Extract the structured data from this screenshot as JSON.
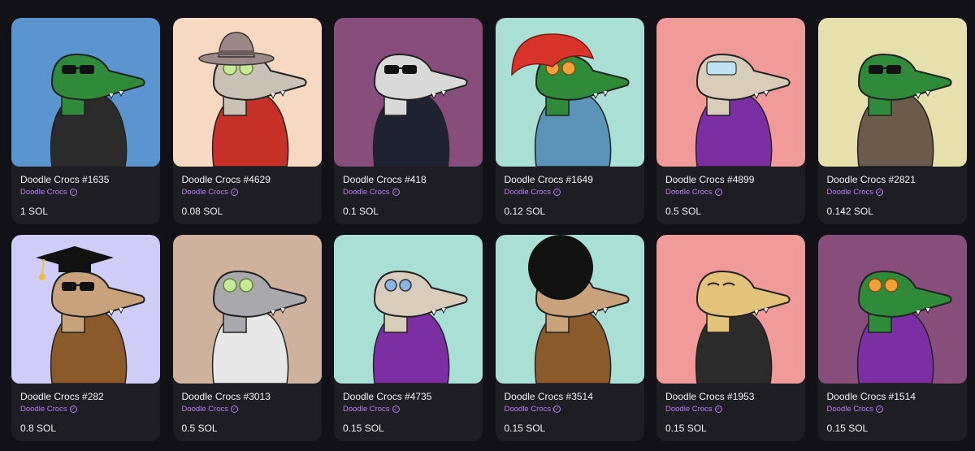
{
  "items": [
    {
      "name": "Doodle Crocs #1635",
      "collection": "Doodle Crocs",
      "price": "1 SOL",
      "bg": "#5a95cf",
      "skin": "#2f8a3a",
      "outfit": "#2b2b2b",
      "hat": "none",
      "eyes": "sunglasses"
    },
    {
      "name": "Doodle Crocs #4629",
      "collection": "Doodle Crocs",
      "price": "0.08 SOL",
      "bg": "#f6d8c3",
      "skin": "#c9c1b6",
      "outfit": "#c63027",
      "hat": "fedora",
      "eyes": "cucumbers"
    },
    {
      "name": "Doodle Crocs #418",
      "collection": "Doodle Crocs",
      "price": "0.1 SOL",
      "bg": "#874e7b",
      "skin": "#d9d9d9",
      "outfit": "#1f2230",
      "hat": "none",
      "eyes": "sunglasses"
    },
    {
      "name": "Doodle Crocs #1649",
      "collection": "Doodle Crocs",
      "price": "0.12 SOL",
      "bg": "#a9dfd4",
      "skin": "#2f8a3a",
      "outfit": "#5b94b8",
      "hat": "hair-red",
      "eyes": "round-orange"
    },
    {
      "name": "Doodle Crocs #4899",
      "collection": "Doodle Crocs",
      "price": "0.5 SOL",
      "bg": "#f09a9a",
      "skin": "#d8ccba",
      "outfit": "#7b2fa3",
      "hat": "none",
      "eyes": "mask"
    },
    {
      "name": "Doodle Crocs #2821",
      "collection": "Doodle Crocs",
      "price": "0.142 SOL",
      "bg": "#e6e1ac",
      "skin": "#2f8a3a",
      "outfit": "#6b5b4a",
      "hat": "none",
      "eyes": "sunglasses"
    },
    {
      "name": "Doodle Crocs #282",
      "collection": "Doodle Crocs",
      "price": "0.8 SOL",
      "bg": "#cfcdf7",
      "skin": "#c8a27a",
      "outfit": "#8a5a2b",
      "hat": "grad-cap",
      "eyes": "sunglasses"
    },
    {
      "name": "Doodle Crocs #3013",
      "collection": "Doodle Crocs",
      "price": "0.5 SOL",
      "bg": "#cfb29d",
      "skin": "#a9a9ad",
      "outfit": "#e8e8e8",
      "hat": "none",
      "eyes": "cucumbers"
    },
    {
      "name": "Doodle Crocs #4735",
      "collection": "Doodle Crocs",
      "price": "0.15 SOL",
      "bg": "#a9dfd4",
      "skin": "#d8ccba",
      "outfit": "#7b2fa3",
      "hat": "none",
      "eyes": "round-blue"
    },
    {
      "name": "Doodle Crocs #3514",
      "collection": "Doodle Crocs",
      "price": "0.15 SOL",
      "bg": "#a9dfd4",
      "skin": "#c8a27a",
      "outfit": "#8a5a2b",
      "hat": "afro",
      "eyes": "glasses"
    },
    {
      "name": "Doodle Crocs #1953",
      "collection": "Doodle Crocs",
      "price": "0.15 SOL",
      "bg": "#f09a9a",
      "skin": "#e3c27a",
      "outfit": "#2b2b2b",
      "hat": "none",
      "eyes": "sleepy"
    },
    {
      "name": "Doodle Crocs #1514",
      "collection": "Doodle Crocs",
      "price": "0.15 SOL",
      "bg": "#874e7b",
      "skin": "#2f8a3a",
      "outfit": "#7b2fa3",
      "hat": "none",
      "eyes": "round-orange"
    }
  ]
}
